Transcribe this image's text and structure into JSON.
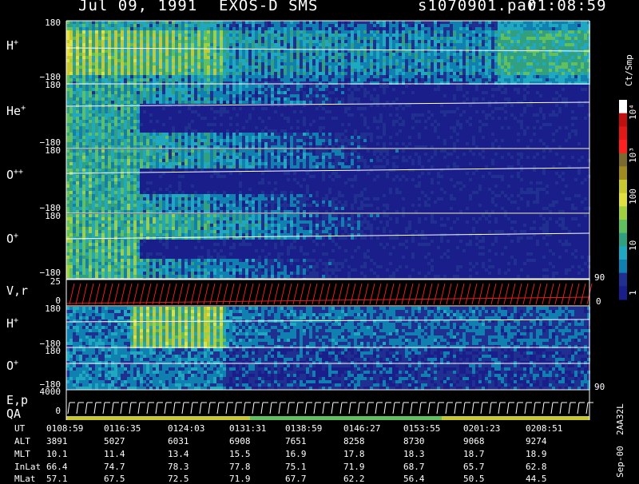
{
  "header": {
    "date": "Jul 09, 1991",
    "instrument": "EXOS-D SMS",
    "file": "s1070901.par",
    "time": "01:08:59"
  },
  "colors": {
    "bg": "#1a1e8a",
    "frame": "#ffffff",
    "red_trace": "#e02020",
    "colorbar": [
      "#ffffff",
      "#c01010",
      "#e01818",
      "#ff2020",
      "#7a6a30",
      "#a08a20",
      "#c8c830",
      "#e0e040",
      "#a0d040",
      "#60c060",
      "#30a080",
      "#20a8c0",
      "#1080b0",
      "#203090",
      "#1a1e8a"
    ]
  },
  "panels": [
    {
      "id": "h-plus",
      "label": "H",
      "charge": "+",
      "ytop": "180",
      "ybot": "−180"
    },
    {
      "id": "he-plus",
      "label": "He",
      "charge": "+",
      "ytop": "180",
      "ybot": "−180"
    },
    {
      "id": "o-plusplus",
      "label": "O",
      "charge": "++",
      "ytop": "180",
      "ybot": "−180"
    },
    {
      "id": "o-plus",
      "label": "O",
      "charge": "+",
      "ytop": "180",
      "ybot": "−180"
    },
    {
      "id": "v-r",
      "label": "V,r",
      "charge": "",
      "ytop": "25",
      "ybot": "0",
      "rtop": "90",
      "rbot": "0"
    },
    {
      "id": "h-plus-2",
      "label": "H",
      "charge": "+",
      "ytop": "180",
      "ybot": "−180"
    },
    {
      "id": "o-plus-2",
      "label": "O",
      "charge": "+",
      "ytop": "180",
      "ybot": "−180",
      "rbot": "90"
    },
    {
      "id": "e-p",
      "label": "E,p",
      "label2": "QA",
      "ytop": "4000",
      "ybot": "0"
    }
  ],
  "colorbar": {
    "unit": "Ct/Smp",
    "ticks": [
      "10⁴",
      "10³",
      "100",
      "10",
      "1"
    ],
    "scale": "log"
  },
  "footer": {
    "labels": [
      "UT",
      "ALT",
      "MLT",
      "InLat",
      "MLat"
    ],
    "rows": [
      [
        "0108:59",
        "0116:35",
        "0124:03",
        "0131:31",
        "0138:59",
        "0146:27",
        "0153:55",
        "0201:23",
        "0208:51"
      ],
      [
        "3891",
        "5027",
        "6031",
        "6908",
        "7651",
        "8258",
        "8730",
        "9068",
        "9274"
      ],
      [
        "10.1",
        "11.4",
        "13.4",
        "15.5",
        "16.9",
        "17.8",
        "18.3",
        "18.7",
        "18.9"
      ],
      [
        "66.4",
        "74.7",
        "78.3",
        "77.8",
        "75.1",
        "71.9",
        "68.7",
        "65.7",
        "62.8"
      ],
      [
        "57.1",
        "67.5",
        "72.5",
        "71.9",
        "67.7",
        "62.2",
        "56.4",
        "50.5",
        "44.5"
      ]
    ],
    "version": "Sep-00  2AA32L"
  },
  "chart_data": {
    "type": "heatmap",
    "x_time_ut": [
      "0108:59",
      "0116:35",
      "0124:03",
      "0131:31",
      "0138:59",
      "0146:27",
      "0153:55",
      "0201:23",
      "0208:51"
    ],
    "panels": [
      "H+",
      "He+",
      "O++",
      "O+",
      "V,r",
      "H+",
      "O+",
      "E,p QA"
    ],
    "yrange_pitch": [
      -180,
      180
    ],
    "color_scale": {
      "unit": "Ct/Smp",
      "min": 1,
      "max": 10000,
      "log": true
    }
  }
}
